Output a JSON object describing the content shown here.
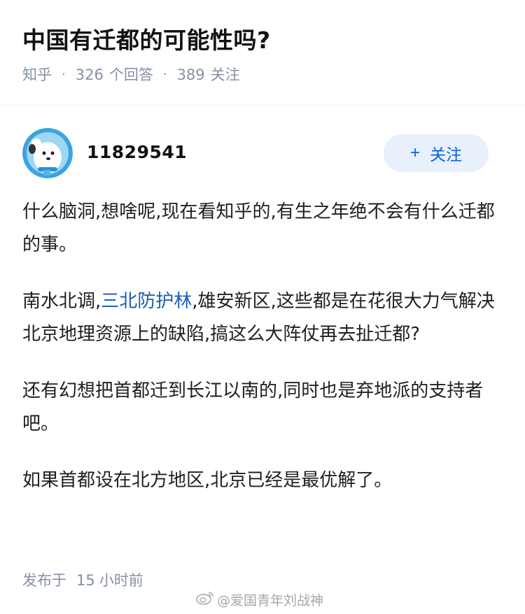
{
  "question": {
    "title": "中国有迁都的可能性吗?",
    "source": "知乎",
    "answers_count": "326",
    "answers_label": "个回答",
    "followers_count": "389",
    "followers_label": "关注",
    "separator": "·"
  },
  "author": {
    "name": "11829541",
    "avatar_icon": "cartoon-avatar-icon",
    "follow_plus": "+",
    "follow_label": "关注"
  },
  "answer": {
    "p1": "什么脑洞,想啥呢,现在看知乎的,有生之年绝不会有什么迁都的事。",
    "p2_before": "南水北调,",
    "p2_link": "三北防护林",
    "p2_after": ",雄安新区,这些都是在花很大力气解决北京地理资源上的缺陷,搞这么大阵仗再去扯迁都?",
    "p3": "还有幻想把首都迁到长江以南的,同时也是弃地派的支持者吧。",
    "p4": "如果首都设在北方地区,北京已经是最优解了。"
  },
  "footer": {
    "posted_prefix": "发布于",
    "posted_num": "15",
    "posted_suffix": "小时前"
  },
  "watermark": {
    "text": "@爱国青年刘战神",
    "icon": "weibo-icon"
  },
  "colors": {
    "link": "#1b5fb9",
    "meta": "#8590a6",
    "follow_bg": "#e8f0fb",
    "follow_text": "#0a63d6"
  }
}
